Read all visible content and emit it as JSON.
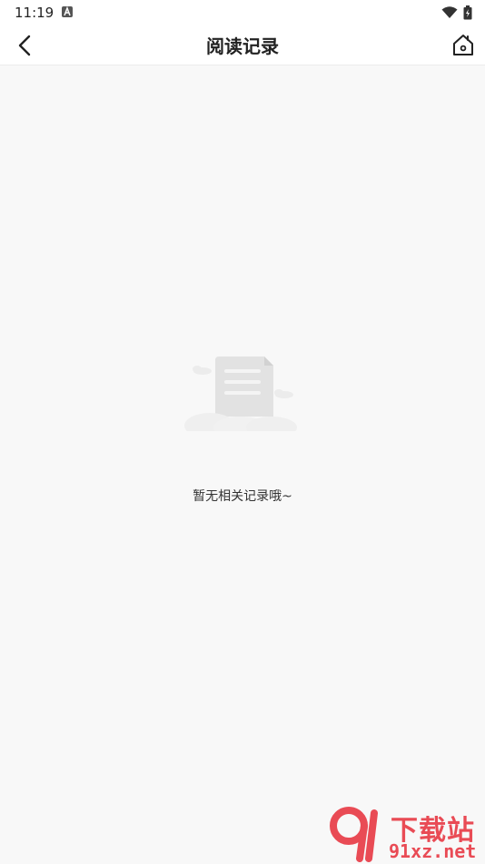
{
  "status": {
    "time": "11:19"
  },
  "header": {
    "title": "阅读记录"
  },
  "empty_state": {
    "message": "暂无相关记录哦~"
  },
  "watermark": {
    "top_text": "下载站",
    "bottom_text": "91xz.net"
  },
  "colors": {
    "watermark": "#e94b55",
    "background": "#f8f8f8"
  }
}
